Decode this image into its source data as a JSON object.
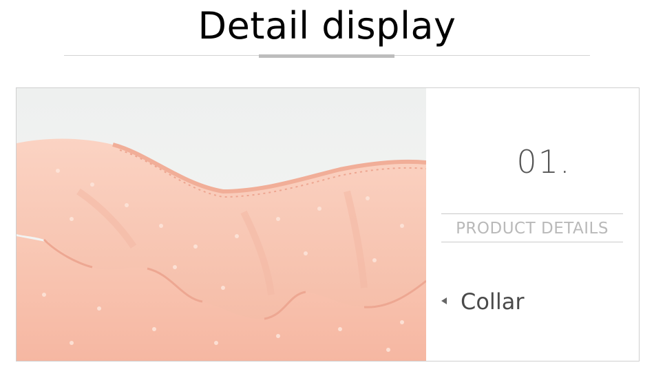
{
  "header": {
    "title_word1": "Detail",
    "title_word2": "display"
  },
  "detail": {
    "number": "01.",
    "section_label": "PRODUCT DETAILS",
    "arrow_icon": "caret-left-icon",
    "item_label": "Collar"
  },
  "colors": {
    "title_gradient_start": "#4d8ff0",
    "title_gradient_end": "#ef6aa9",
    "fabric_pink": "#f7c3b0"
  }
}
